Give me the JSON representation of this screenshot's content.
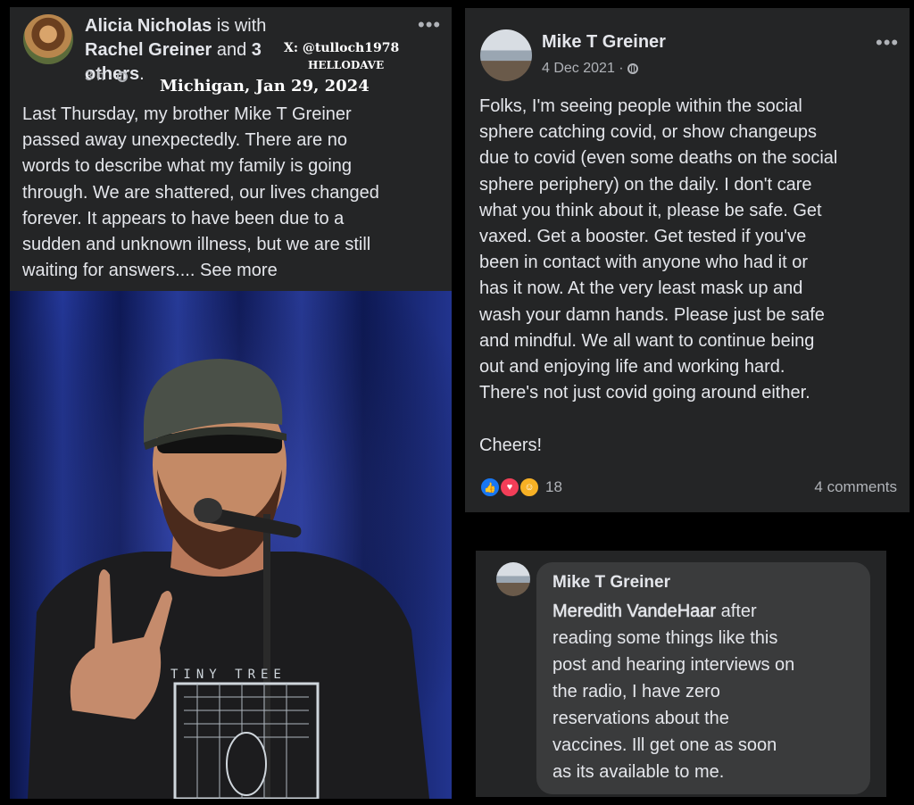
{
  "post1": {
    "author": "Alicia Nicholas",
    "with_text": " is with ",
    "tagged": "Rachel Greiner",
    "and_text": " and ",
    "others": "3 others",
    "period": ".",
    "time": "3 h",
    "dot": "·",
    "body": "Last Thursday, my brother Mike T Greiner\npassed away unexpectedly. There are no\nwords to describe what my family is going\nthrough. We are shattered, our lives changed\nforever. It appears to have been due to a\nsudden and unknown illness, but we are still\nwaiting for answers....",
    "see_more": " See more"
  },
  "watermark": {
    "line1": "X: @tulloch1978",
    "line2": "HELLODAVE",
    "line3": "Michigan, Jan 29, 2024"
  },
  "post2": {
    "author": "Mike T Greiner",
    "date": "4 Dec 2021",
    "dot": "·",
    "body": "Folks, I'm seeing people within the social\nsphere catching covid, or show changeups\ndue to covid (even some deaths on the social\nsphere periphery) on the daily.  I don't care\nwhat you think about it, please be safe.  Get\nvaxed.  Get a booster. Get tested if you've\nbeen in contact with anyone who had it or\nhas it now.   At the very least mask up and\nwash your damn hands.  Please just be safe\nand mindful.  We all want to continue being\nout and enjoying life and working hard.\nThere's not just covid going around either.\n\nCheers!",
    "reaction_count": "18",
    "comments": "4 comments"
  },
  "comment": {
    "author": "Mike T Greiner",
    "mention": "Meredith VandeHaar",
    "body": " after\nreading some things like this\npost and hearing interviews on\nthe radio, I have zero\nreservations about the\nvaccines.  Ill get one as soon\nas its available to me."
  },
  "photo": {
    "shirt_text": "TINY TREE"
  },
  "icons": {
    "more": "more-options-icon",
    "globe": "public-globe-icon",
    "like": "like-reaction-icon",
    "love": "love-reaction-icon",
    "care": "care-reaction-icon"
  },
  "colors": {
    "panel": "#242526",
    "text": "#e4e6eb",
    "muted": "#b0b3b8",
    "like": "#1877f2",
    "love": "#f33e58",
    "care": "#f7b125"
  }
}
